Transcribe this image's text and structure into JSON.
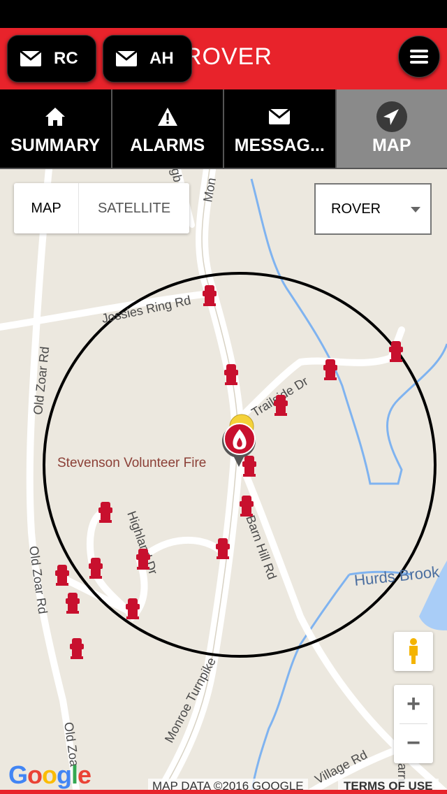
{
  "header": {
    "title": "ROVER",
    "chips": [
      {
        "label": "RC",
        "icon": "envelope-icon"
      },
      {
        "label": "AH",
        "icon": "envelope-icon"
      }
    ],
    "menu_icon": "hamburger-menu-icon",
    "color": "#e8232b"
  },
  "tabs": [
    {
      "label": "SUMMARY",
      "icon": "home-icon",
      "active": false
    },
    {
      "label": "ALARMS",
      "icon": "warning-icon",
      "active": false
    },
    {
      "label": "MESSAG...",
      "icon": "envelope-icon",
      "active": false
    },
    {
      "label": "MAP",
      "icon": "navigation-arrow-icon",
      "active": true
    }
  ],
  "map": {
    "type_control": {
      "map_label": "MAP",
      "satellite_label": "SATELLITE",
      "selected": "MAP"
    },
    "unit_select": {
      "value": "ROVER"
    },
    "station_label": "Stevenson Volunteer Fire",
    "streets": {
      "jossies_ring": "Jossies Ring Rd",
      "old_zoar_1": "Old Zoar Rd",
      "old_zoar_2": "Old Zoar Rd",
      "old_zoar_3": "Old Zoa",
      "monroe": "Monroe Turnpike",
      "mon": "Mon",
      "barn_hill": "Barn Hill Rd",
      "highland": "Highland Dr",
      "trailside": "Trailside Dr",
      "village": "Village Rd",
      "hurds_brook": "Hurds Brook",
      "gb": "gb",
      "arn": "arn"
    },
    "google_logo": "Google",
    "attribution": "MAP DATA ©2016 GOOGLE",
    "terms": "TERMS OF USE",
    "zoom_in": "+",
    "zoom_out": "−",
    "hydrant_icon": "fire-hydrant-icon",
    "hydrant_color": "#c8102e",
    "water_color": "#7fb3f0"
  }
}
